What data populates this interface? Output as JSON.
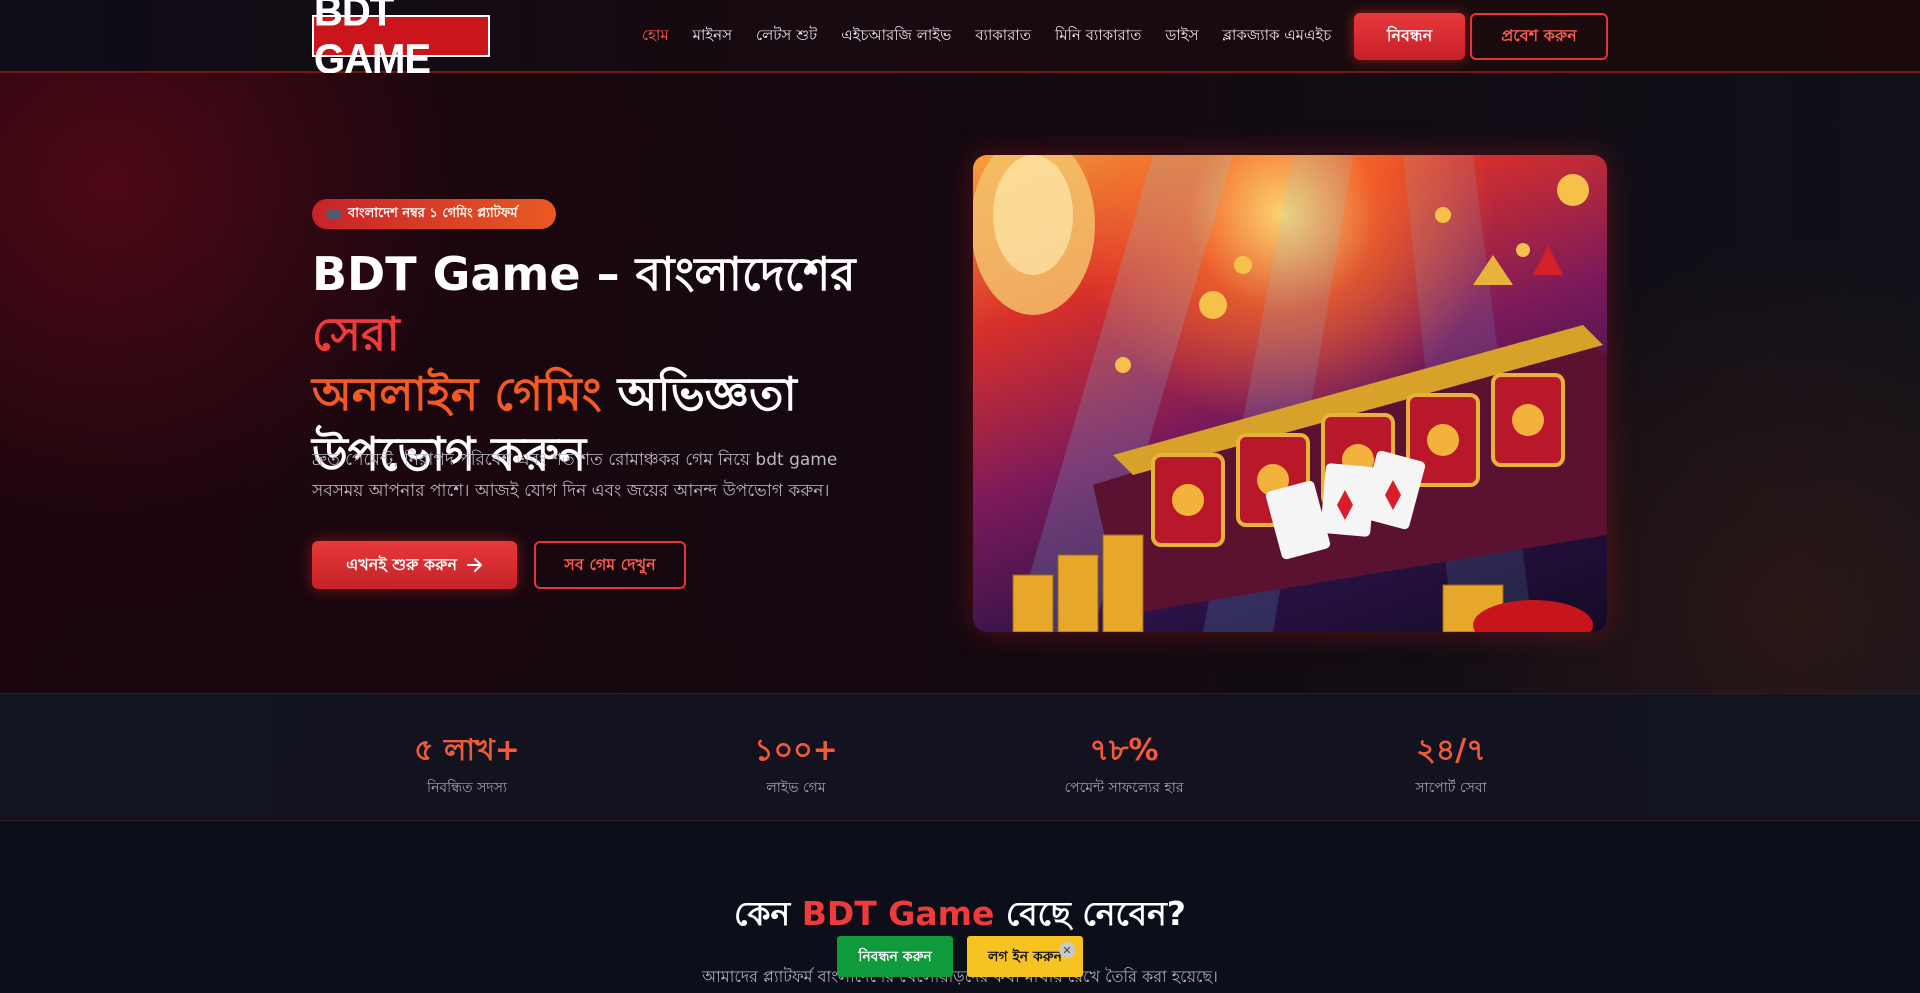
{
  "header": {
    "logo_text": "BDT GAME",
    "nav": [
      {
        "label": "হোম",
        "active": true
      },
      {
        "label": "মাইনস"
      },
      {
        "label": "লেটস শুট"
      },
      {
        "label": "এইচআরজি লাইভ"
      },
      {
        "label": "ব্যাকারাত"
      },
      {
        "label": "মিনি ব্যাকারাত"
      },
      {
        "label": "ডাইস"
      },
      {
        "label": "ব্লাকজ্যাক এমএইচ"
      }
    ],
    "register_label": "নিবন্ধন",
    "login_label": "প্রবেশ করুন"
  },
  "hero": {
    "badge": "বাংলাদেশ নম্বর ১ গেমিং প্ল্যাটফর্ম",
    "badge_icon": "gamepad-icon",
    "title_part1": "BDT Game – বাংলাদেশের ",
    "title_highlight1": "সেরা",
    "title_highlight2": "অনলাইন গেমিং",
    "title_part2": " অভিজ্ঞতা উপভোগ করুন",
    "description": "দ্রুত পেমেন্ট, নিরাপদ পরিবেশ এবং শত শত রোমাঞ্চকর গেম নিয়ে bdt game সবসময় আপনার পাশে। আজই যোগ দিন এবং জয়ের আনন্দ উপভোগ করুন।",
    "start_label": "এখনই শুরু করুন",
    "start_icon": "arrow-right-icon",
    "games_label": "সব গেম দেখুন"
  },
  "stats": [
    {
      "value": "৫ লাখ+",
      "label": "নিবন্ধিত সদস্য"
    },
    {
      "value": "১০০+",
      "label": "লাইভ গেম"
    },
    {
      "value": "৭৮%",
      "label": "পেমেন্ট সাফল্যের হার"
    },
    {
      "value": "২৪/৭",
      "label": "সাপোর্ট সেবা"
    }
  ],
  "why": {
    "title_part1": "কেন ",
    "title_highlight": "BDT Game",
    "title_part2": " বেছে নেবেন?",
    "description": "আমাদের প্ল্যাটফর্ম বাংলাদেশের খেলোয়াড়দের কথা মাথায় রেখে তৈরি করা হয়েছে।"
  },
  "floating": {
    "register_label": "নিবন্ধন করুন",
    "login_label": "লগ ইন করুন",
    "close_icon": "close-icon",
    "close_glyph": "✕"
  },
  "colors": {
    "accent_red": "#e3353a",
    "accent_orange": "#f15a24",
    "float_green": "#0f9a3c",
    "float_yellow": "#f7c320"
  }
}
